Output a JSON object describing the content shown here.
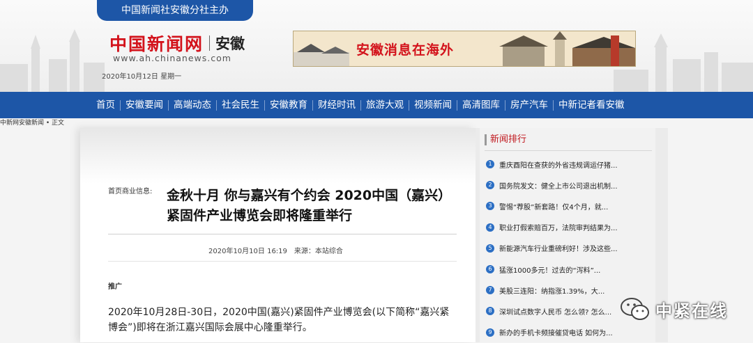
{
  "header": {
    "top_tab": "中国新闻社安徽分社主办",
    "logo_cn": "中国新闻网",
    "logo_region": "安徽",
    "logo_url": "www.ah.chinanews.com",
    "date": "2020年10月12日  星期一",
    "banner_text": "安徽消息在海外"
  },
  "nav": {
    "items": [
      "首页",
      "安徽要闻",
      "高端动态",
      "社会民生",
      "安徽教育",
      "财经时讯",
      "旅游大观",
      "视频新闻",
      "高清图库",
      "房产汽车",
      "中新记者看安徽"
    ]
  },
  "breadcrumb": "中新网安徽新闻 • 正文",
  "article": {
    "crumb": "首页商业信息:",
    "title": "金秋十月 你与嘉兴有个约会 2020中国（嘉兴）紧固件产业博览会即将隆重举行",
    "datetime": "2020年10月10日 16:19",
    "source": "来源：本站综合",
    "promo_label": "推广",
    "paragraph": "2020年10月28日-30日，2020中国(嘉兴)紧固件产业博览会(以下简称“嘉兴紧博会”)即将在浙江嘉兴国际会展中心隆重举行。"
  },
  "sidebar": {
    "title": "新闻排行",
    "items": [
      {
        "num": "1",
        "text": "重庆酉阳在查获的外省违规调运仔猪..."
      },
      {
        "num": "2",
        "text": "国务院发文：健全上市公司退出机制..."
      },
      {
        "num": "3",
        "text": "警惕“荐股”新套路！仅4个月，就..."
      },
      {
        "num": "4",
        "text": "职业打假索赔百万，法院审判结果为..."
      },
      {
        "num": "5",
        "text": "新能源汽车行业重磅利好！涉及这些..."
      },
      {
        "num": "6",
        "text": "猛涨1000多元！过去的“泻料”..."
      },
      {
        "num": "7",
        "text": "美股三连阳：纳指涨1.39%，大..."
      },
      {
        "num": "8",
        "text": "深圳试点数字人民币 怎么领? 怎么..."
      },
      {
        "num": "9",
        "text": "新办的手机卡频接催贷电话 如何为..."
      }
    ]
  },
  "watermark": {
    "text": "中紧在线"
  }
}
